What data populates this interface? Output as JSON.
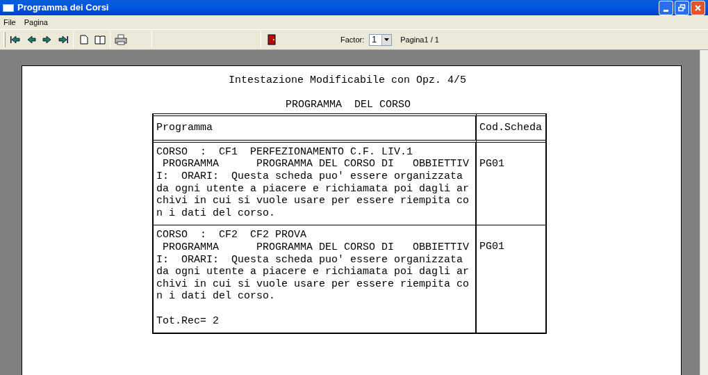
{
  "window": {
    "title": "Programma dei Corsi"
  },
  "menu": [
    "File",
    "Pagina"
  ],
  "toolbar": {
    "factor_label": "Factor:",
    "factor_value": "1",
    "page_info": "Pagina1 / 1"
  },
  "report": {
    "header": "Intestazione Modificabile con Opz. 4/5",
    "title": "PROGRAMMA  DEL CORSO",
    "columns": [
      "Programma",
      "Cod.Scheda"
    ],
    "rows": [
      {
        "lines": [
          "CORSO  :  CF1  PERFEZIONAMENTO C.F. LIV.1",
          " PROGRAMMA      PROGRAMMA DEL CORSO DI   OBBIETTIV",
          "I:  ORARI:  Questa scheda puo' essere organizzata",
          "da ogni utente a piacere e richiamata poi dagli ar",
          "chivi in cui si vuole usare per essere riempita co",
          "n i dati del corso."
        ],
        "code": "PG01"
      },
      {
        "lines": [
          "CORSO  :  CF2  CF2 PROVA",
          " PROGRAMMA      PROGRAMMA DEL CORSO DI   OBBIETTIV",
          "I:  ORARI:  Questa scheda puo' essere organizzata",
          "da ogni utente a piacere e richiamata poi dagli ar",
          "chivi in cui si vuole usare per essere riempita co",
          "n i dati del corso."
        ],
        "code": "PG01"
      }
    ],
    "total": "Tot.Rec= 2"
  }
}
